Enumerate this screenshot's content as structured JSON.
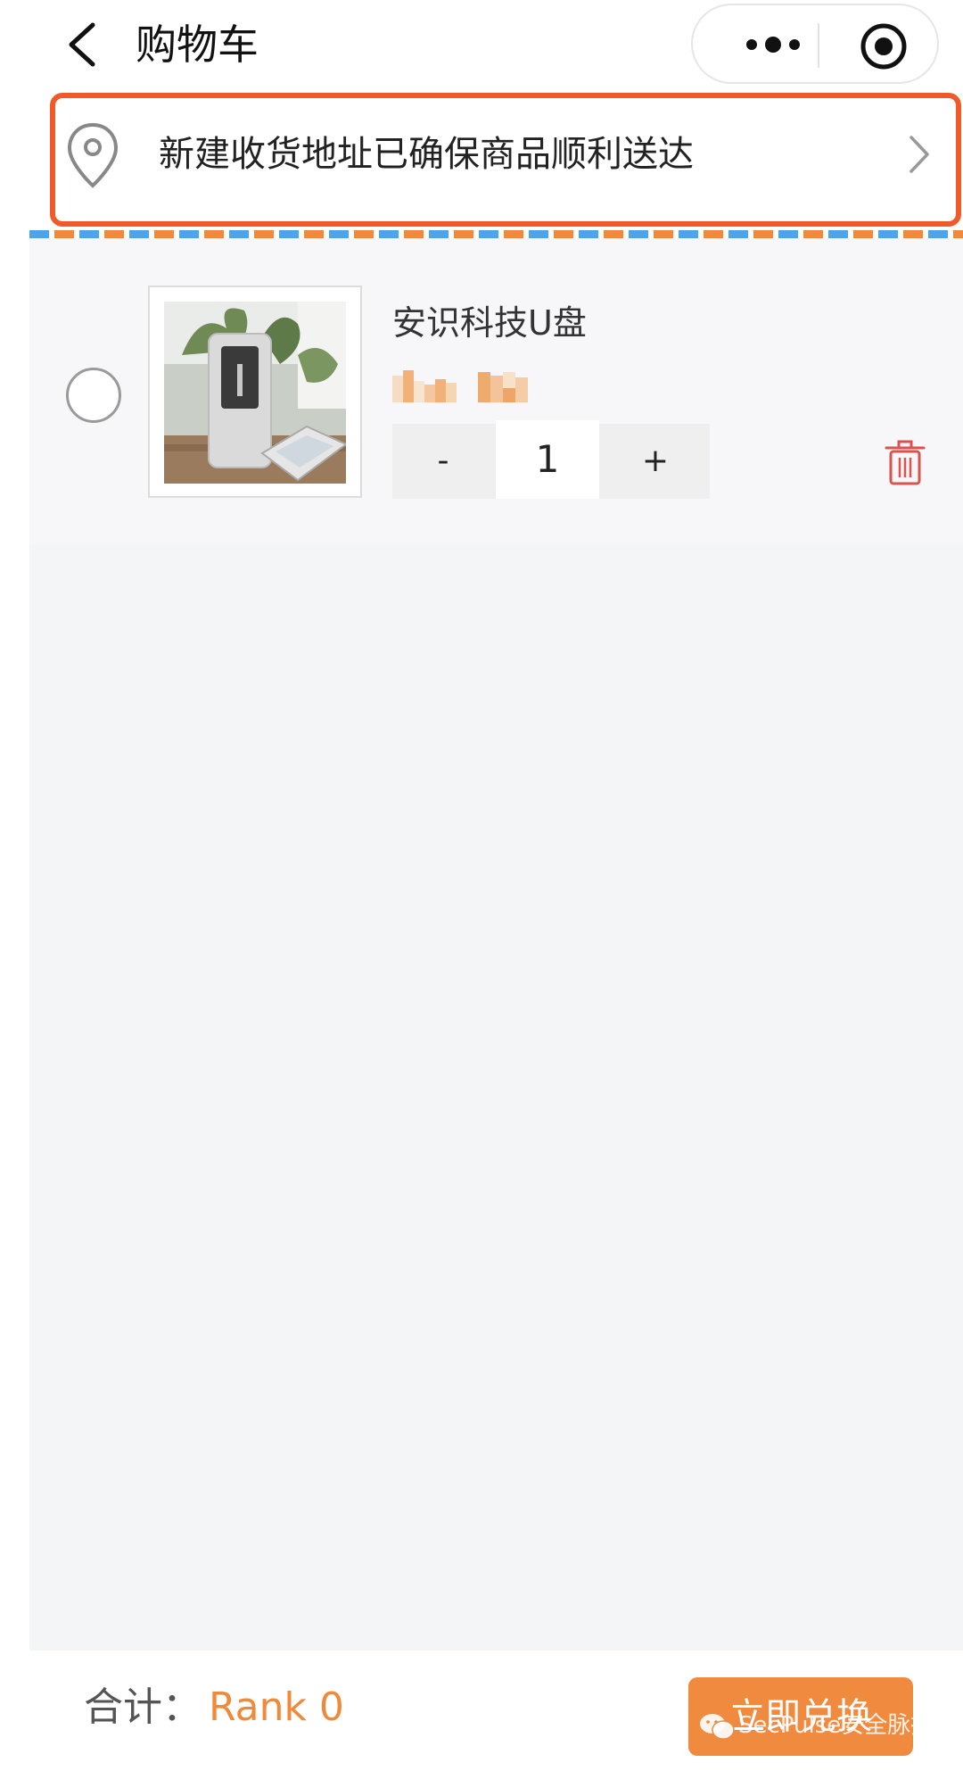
{
  "navbar": {
    "title": "购物车"
  },
  "address": {
    "text": "新建收货地址已确保商品顺利送达"
  },
  "cart": {
    "items": [
      {
        "name": "安识科技U盘",
        "quantity": "1",
        "minus_label": "-",
        "plus_label": "+"
      }
    ]
  },
  "footer": {
    "total_label": "合计：",
    "total_value": "Rank 0",
    "redeem_label": "立即兑换"
  },
  "watermark": {
    "text": "SecPulse安全脉搏"
  },
  "colors": {
    "accent": "#f08a3f",
    "highlight_outline": "#f05a28",
    "stripe_blue": "#4fa3e8",
    "stripe_orange": "#f0893e",
    "trash": "#d9534f"
  },
  "icons": [
    "back-icon",
    "more-icon",
    "close-target-icon",
    "location-pin-icon",
    "chevron-right-icon",
    "trash-icon",
    "wechat-icon"
  ]
}
